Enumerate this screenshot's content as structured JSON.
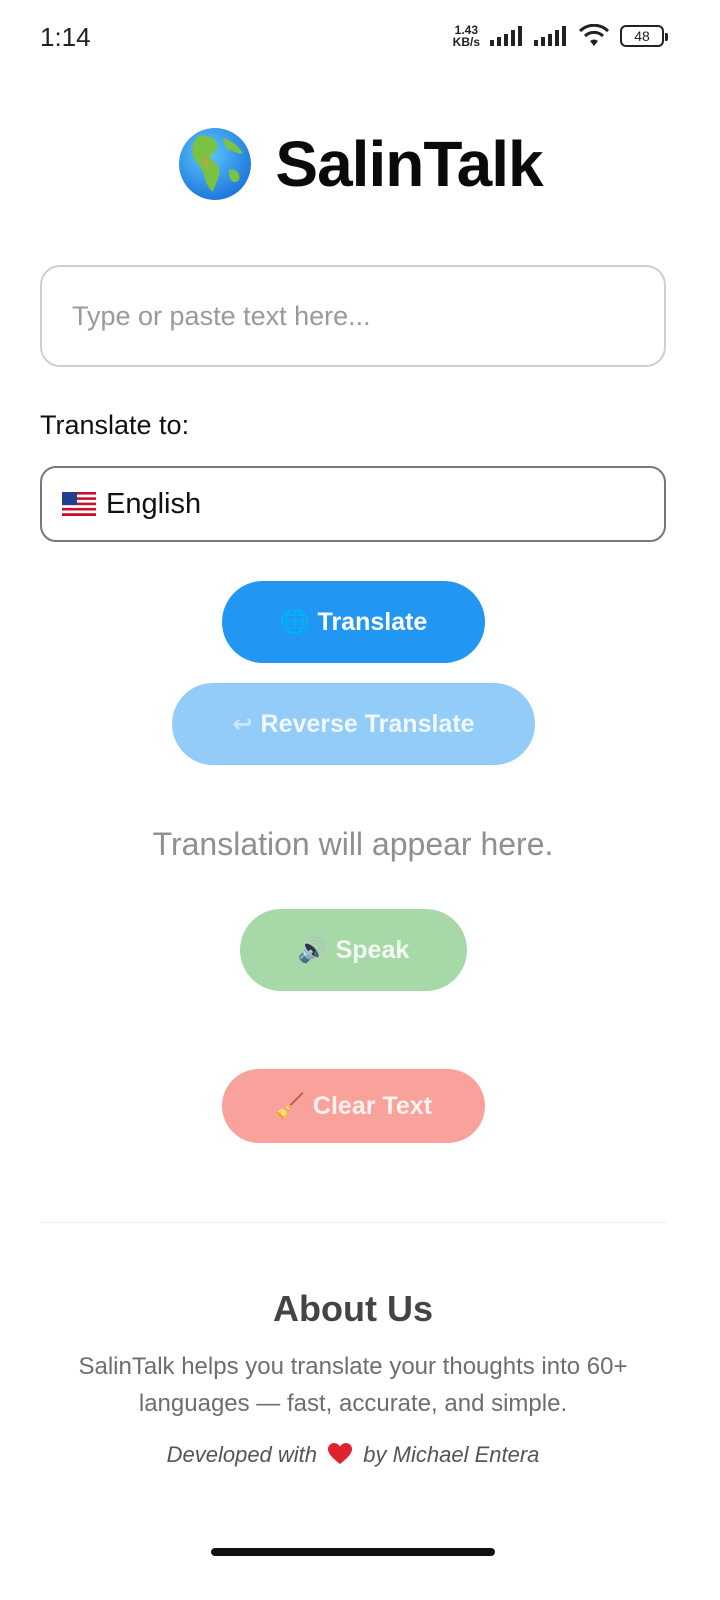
{
  "status_bar": {
    "time": "1:14",
    "net_speed_value": "1.43",
    "net_speed_unit": "KB/s",
    "battery": "48"
  },
  "header": {
    "icon": "globe-icon",
    "title": "SalinTalk"
  },
  "input": {
    "placeholder": "Type or paste text here...",
    "value": ""
  },
  "target_language": {
    "label": "Translate to:",
    "selected_flag_icon": "us-flag-icon",
    "selected_value": "English"
  },
  "buttons": {
    "translate": {
      "icon": "🌐",
      "label": "Translate"
    },
    "reverse": {
      "icon": "↩",
      "label": "Reverse Translate"
    },
    "speak": {
      "icon": "🔊",
      "label": "Speak"
    },
    "clear": {
      "icon": "🧹",
      "label": "Clear Text"
    }
  },
  "output": {
    "placeholder": "Translation will appear here."
  },
  "about": {
    "title": "About Us",
    "description": "SalinTalk helps you translate your thoughts into 60+ languages — fast, accurate, and simple.",
    "credit_prefix": "Developed with",
    "credit_suffix": "by Michael Entera"
  },
  "colors": {
    "primary": "#2196f3",
    "primary_disabled": "#93ccf9",
    "speak_disabled": "#a6d8a8",
    "clear_disabled": "#f9a19b"
  }
}
